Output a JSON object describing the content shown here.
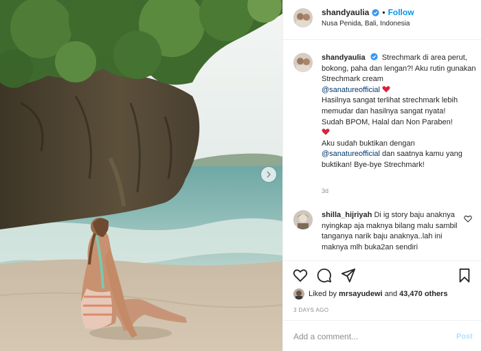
{
  "header": {
    "username": "shandyaulia",
    "separator": "•",
    "follow_label": "Follow",
    "location": "Nusa Penida, Bali, Indonesia"
  },
  "caption": {
    "username": "shandyaulia",
    "line1": "Strechmark di area perut, bokong, paha dan lengan?! Aku rutin gunakan Strechmark cream",
    "mention1": "@sanatureofficial",
    "line2": "Hasilnya sangat terlihat strechmark lebih memudar dan hasilnya sangat nyata!",
    "line3": "Sudah BPOM, Halal dan Non Paraben!",
    "line4": "Aku sudah buktikan dengan",
    "mention2": "@sanatureofficial",
    "line5": "dan saatnya kamu yang buktikan! Bye-bye Strechmark!",
    "time": "3d"
  },
  "comment2": {
    "username": "shilla_hijriyah",
    "text": "Di ig story baju anaknya nyingkap aja maknya bilang malu sambil tanganya narik baju anaknya..lah ini maknya mlh buka2an sendiri"
  },
  "likes": {
    "prefix": "Liked by",
    "liker": "mrsayudewi",
    "connector": "and",
    "count": "43,470 others"
  },
  "posted": "3 DAYS AGO",
  "add_comment": {
    "placeholder": "Add a comment...",
    "post_label": "Post"
  },
  "icons": {
    "like": "heart-icon",
    "comment": "comment-icon",
    "share": "share-icon",
    "save": "bookmark-icon",
    "verified": "verified-badge-icon",
    "next": "chevron-right-icon"
  },
  "colors": {
    "link": "#0095f6",
    "mention": "#00376b",
    "muted": "#8e8e8e",
    "heart": "#ed4956",
    "post_disabled": "#b2dffc"
  }
}
